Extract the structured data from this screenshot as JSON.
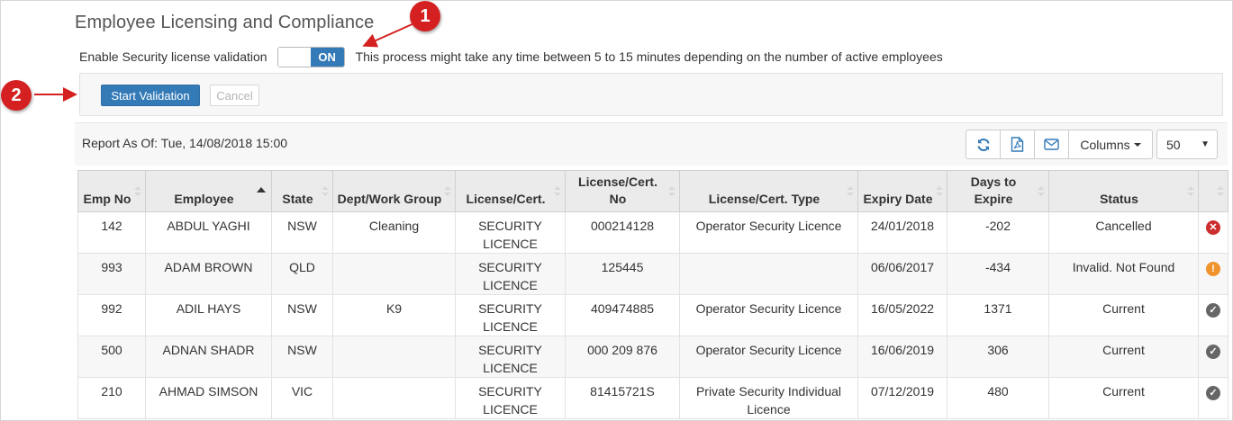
{
  "page": {
    "title": "Employee Licensing and Compliance"
  },
  "toggle": {
    "label": "Enable Security license validation",
    "state_label": "ON",
    "note": "This process might take any time between 5 to 15 minutes depending on the number of active employees"
  },
  "markers": {
    "one": "1",
    "two": "2"
  },
  "validation": {
    "start_label": "Start Validation",
    "cancel_label": "Cancel"
  },
  "report": {
    "as_of": "Report As Of: Tue, 14/08/2018 15:00",
    "columns_label": "Columns",
    "page_size": "50",
    "refresh_icon": "refresh-icon",
    "pdf_icon": "pdf-file-icon",
    "email_icon": "envelope-icon"
  },
  "table": {
    "headers": {
      "emp_no": "Emp No",
      "employee": "Employee",
      "state": "State",
      "dept": "Dept/Work Group",
      "license": "License/Cert.",
      "license_no": "License/Cert. No",
      "license_type": "License/Cert. Type",
      "expiry": "Expiry Date",
      "days": "Days to Expire",
      "status": "Status"
    },
    "rows": [
      {
        "emp_no": "142",
        "employee": "ABDUL YAGHI",
        "state": "NSW",
        "dept": "Cleaning",
        "license": "SECURITY LICENCE",
        "license_no": "000214128",
        "license_type": "Operator Security Licence",
        "expiry": "24/01/2018",
        "days": "-202",
        "status": "Cancelled",
        "icon": "cancel-icon",
        "icon_glyph": "✕"
      },
      {
        "emp_no": "993",
        "employee": "ADAM BROWN",
        "state": "QLD",
        "dept": "",
        "license": "SECURITY LICENCE",
        "license_no": "125445",
        "license_type": "",
        "expiry": "06/06/2017",
        "days": "-434",
        "status": "Invalid. Not Found",
        "icon": "warning-icon",
        "icon_glyph": "!"
      },
      {
        "emp_no": "992",
        "employee": "ADIL HAYS",
        "state": "NSW",
        "dept": "K9",
        "license": "SECURITY LICENCE",
        "license_no": "409474885",
        "license_type": "Operator Security Licence",
        "expiry": "16/05/2022",
        "days": "1371",
        "status": "Current",
        "icon": "check-icon",
        "icon_glyph": "✓"
      },
      {
        "emp_no": "500",
        "employee": "ADNAN SHADR",
        "state": "NSW",
        "dept": "",
        "license": "SECURITY LICENCE",
        "license_no": "000 209 876",
        "license_type": "Operator Security Licence",
        "expiry": "16/06/2019",
        "days": "306",
        "status": "Current",
        "icon": "check-icon",
        "icon_glyph": "✓"
      },
      {
        "emp_no": "210",
        "employee": "AHMAD SIMSON",
        "state": "VIC",
        "dept": "",
        "license": "SECURITY LICENCE",
        "license_no": "81415721S",
        "license_type": "Private Security Individual Licence",
        "expiry": "07/12/2019",
        "days": "480",
        "status": "Current",
        "icon": "check-icon",
        "icon_glyph": "✓"
      }
    ]
  },
  "colors": {
    "primary": "#337ab7",
    "negative": "#d9302c",
    "marker": "#d42020",
    "cancel": "#cc2d2d",
    "warning": "#f0932b",
    "ok": "#666666"
  }
}
